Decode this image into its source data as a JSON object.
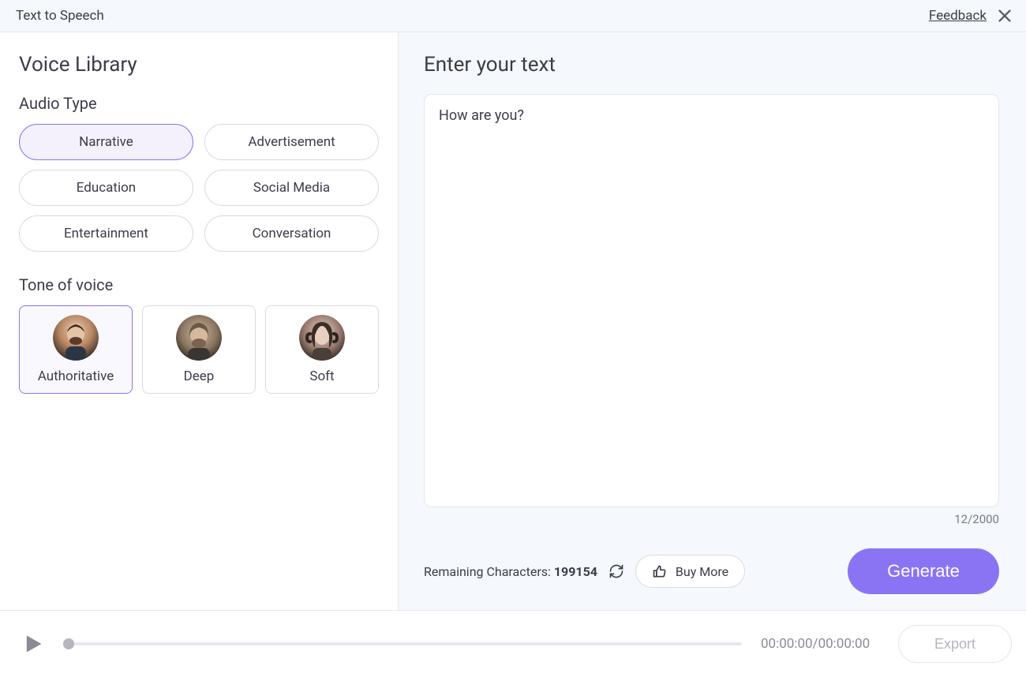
{
  "header": {
    "title": "Text to Speech",
    "feedback": "Feedback"
  },
  "left": {
    "title": "Voice Library",
    "audio_type_label": "Audio Type",
    "audio_types": [
      "Narrative",
      "Advertisement",
      "Education",
      "Social Media",
      "Entertainment",
      "Conversation"
    ],
    "audio_type_selected": 0,
    "tone_label": "Tone of voice",
    "tones": [
      "Authoritative",
      "Deep",
      "Soft"
    ],
    "tone_selected": 0
  },
  "right": {
    "title": "Enter your text",
    "text_value": "How are you?",
    "char_count": "12/2000",
    "remaining_label": "Remaining Characters: ",
    "remaining_value": "199154",
    "buy_more": "Buy More",
    "generate": "Generate"
  },
  "footer": {
    "time": "00:00:00/00:00:00",
    "export": "Export"
  },
  "colors": {
    "accent": "#8b74f4"
  }
}
